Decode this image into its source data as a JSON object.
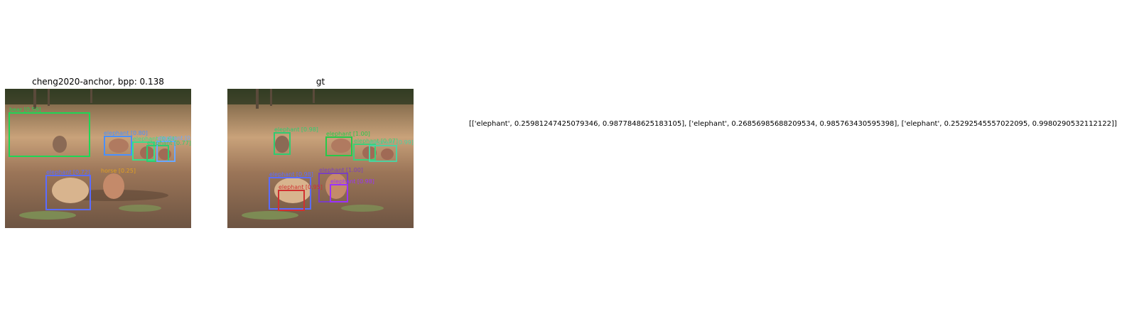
{
  "left_panel": {
    "title": "cheng2020-anchor, bpp: 0.138",
    "detections": [
      {
        "label": "bear [0.59]",
        "color": "#1fd655"
      },
      {
        "label": "elephant [0.80]",
        "color": "#4a90ff"
      },
      {
        "label": "elephant [0.64]",
        "color": "#37e08a"
      },
      {
        "label": "elephant [0.77]",
        "color": "#2ecc71"
      },
      {
        "label": "elephant [0.53]",
        "color": "#6aa8ff"
      },
      {
        "label": "elephant [0.72]",
        "color": "#5b6cff"
      },
      {
        "label": "horse [0.25]",
        "color": "#e0a020"
      }
    ]
  },
  "right_panel": {
    "title": "gt",
    "detections": [
      {
        "label": "elephant [0.98]",
        "color": "#2ecc71"
      },
      {
        "label": "elephant [1.00]",
        "color": "#27c94a"
      },
      {
        "label": "elephant [0.97]",
        "color": "#3ad17a"
      },
      {
        "label": "elephant [0.99]",
        "color": "#4fd0a0"
      },
      {
        "label": "elephant [1.00]",
        "color": "#7a3fc0"
      },
      {
        "label": "elephant [0.98]",
        "color": "#9b30ff"
      },
      {
        "label": "elephant [0.98]",
        "color": "#5b6cff"
      },
      {
        "label": "elephant [0.95]",
        "color": "#d03030"
      }
    ]
  },
  "result_text": "[['elephant', 0.25981247425079346, 0.9877848625183105], ['elephant', 0.26856985688209534, 0.985763430595398], ['elephant', 0.25292545557022095, 0.9980290532112122]]"
}
